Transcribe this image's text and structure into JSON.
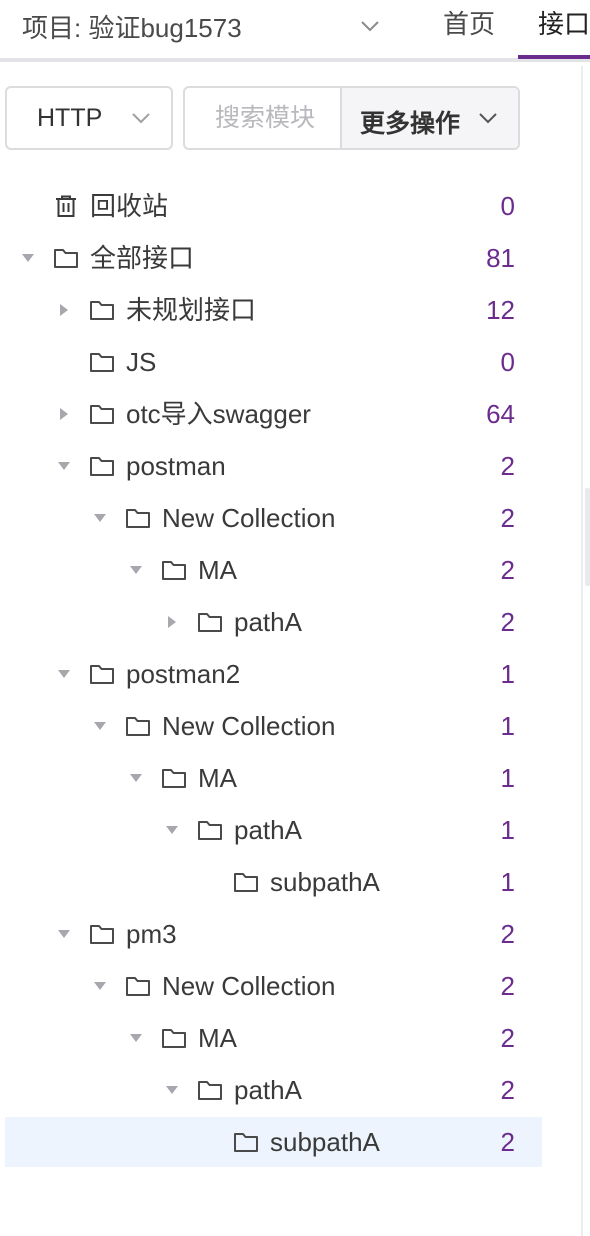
{
  "header": {
    "project_label": "项目: 验证bug1573",
    "tabs": {
      "home": "首页",
      "api": "接口"
    }
  },
  "toolbar": {
    "protocol": "HTTP",
    "search_placeholder": "搜索模块",
    "search_value": "",
    "more_actions": "更多操作"
  },
  "tree": {
    "recycle_bin": {
      "label": "回收站",
      "count": "0"
    },
    "nodes": [
      {
        "label": "全部接口",
        "count": "81",
        "depth": 0,
        "expanded": true,
        "has_children": true
      },
      {
        "label": "未规划接口",
        "count": "12",
        "depth": 1,
        "expanded": false,
        "has_children": true
      },
      {
        "label": "JS",
        "count": "0",
        "depth": 1,
        "expanded": false,
        "has_children": false
      },
      {
        "label": "otc导入swagger",
        "count": "64",
        "depth": 1,
        "expanded": false,
        "has_children": true
      },
      {
        "label": "postman",
        "count": "2",
        "depth": 1,
        "expanded": true,
        "has_children": true
      },
      {
        "label": "New Collection",
        "count": "2",
        "depth": 2,
        "expanded": true,
        "has_children": true
      },
      {
        "label": "MA",
        "count": "2",
        "depth": 3,
        "expanded": true,
        "has_children": true
      },
      {
        "label": "pathA",
        "count": "2",
        "depth": 4,
        "expanded": false,
        "has_children": true
      },
      {
        "label": "postman2",
        "count": "1",
        "depth": 1,
        "expanded": true,
        "has_children": true
      },
      {
        "label": "New Collection",
        "count": "1",
        "depth": 2,
        "expanded": true,
        "has_children": true
      },
      {
        "label": "MA",
        "count": "1",
        "depth": 3,
        "expanded": true,
        "has_children": true
      },
      {
        "label": "pathA",
        "count": "1",
        "depth": 4,
        "expanded": true,
        "has_children": true
      },
      {
        "label": "subpathA",
        "count": "1",
        "depth": 5,
        "expanded": false,
        "has_children": false
      },
      {
        "label": "pm3",
        "count": "2",
        "depth": 1,
        "expanded": true,
        "has_children": true
      },
      {
        "label": "New Collection",
        "count": "2",
        "depth": 2,
        "expanded": true,
        "has_children": true
      },
      {
        "label": "MA",
        "count": "2",
        "depth": 3,
        "expanded": true,
        "has_children": true
      },
      {
        "label": "pathA",
        "count": "2",
        "depth": 4,
        "expanded": true,
        "has_children": true
      },
      {
        "label": "subpathA",
        "count": "2",
        "depth": 5,
        "expanded": false,
        "has_children": false,
        "selected": true
      }
    ]
  },
  "colors": {
    "accent": "#6b2c8e",
    "selected_row_bg": "#eef4fd",
    "border": "#dcdcdf"
  },
  "icons": {
    "recycle_bin": "trash-icon",
    "node": "folder-icon",
    "caret_expanded": "caret-down-icon",
    "caret_collapsed": "caret-right-icon",
    "dropdown": "chevron-down-icon"
  }
}
